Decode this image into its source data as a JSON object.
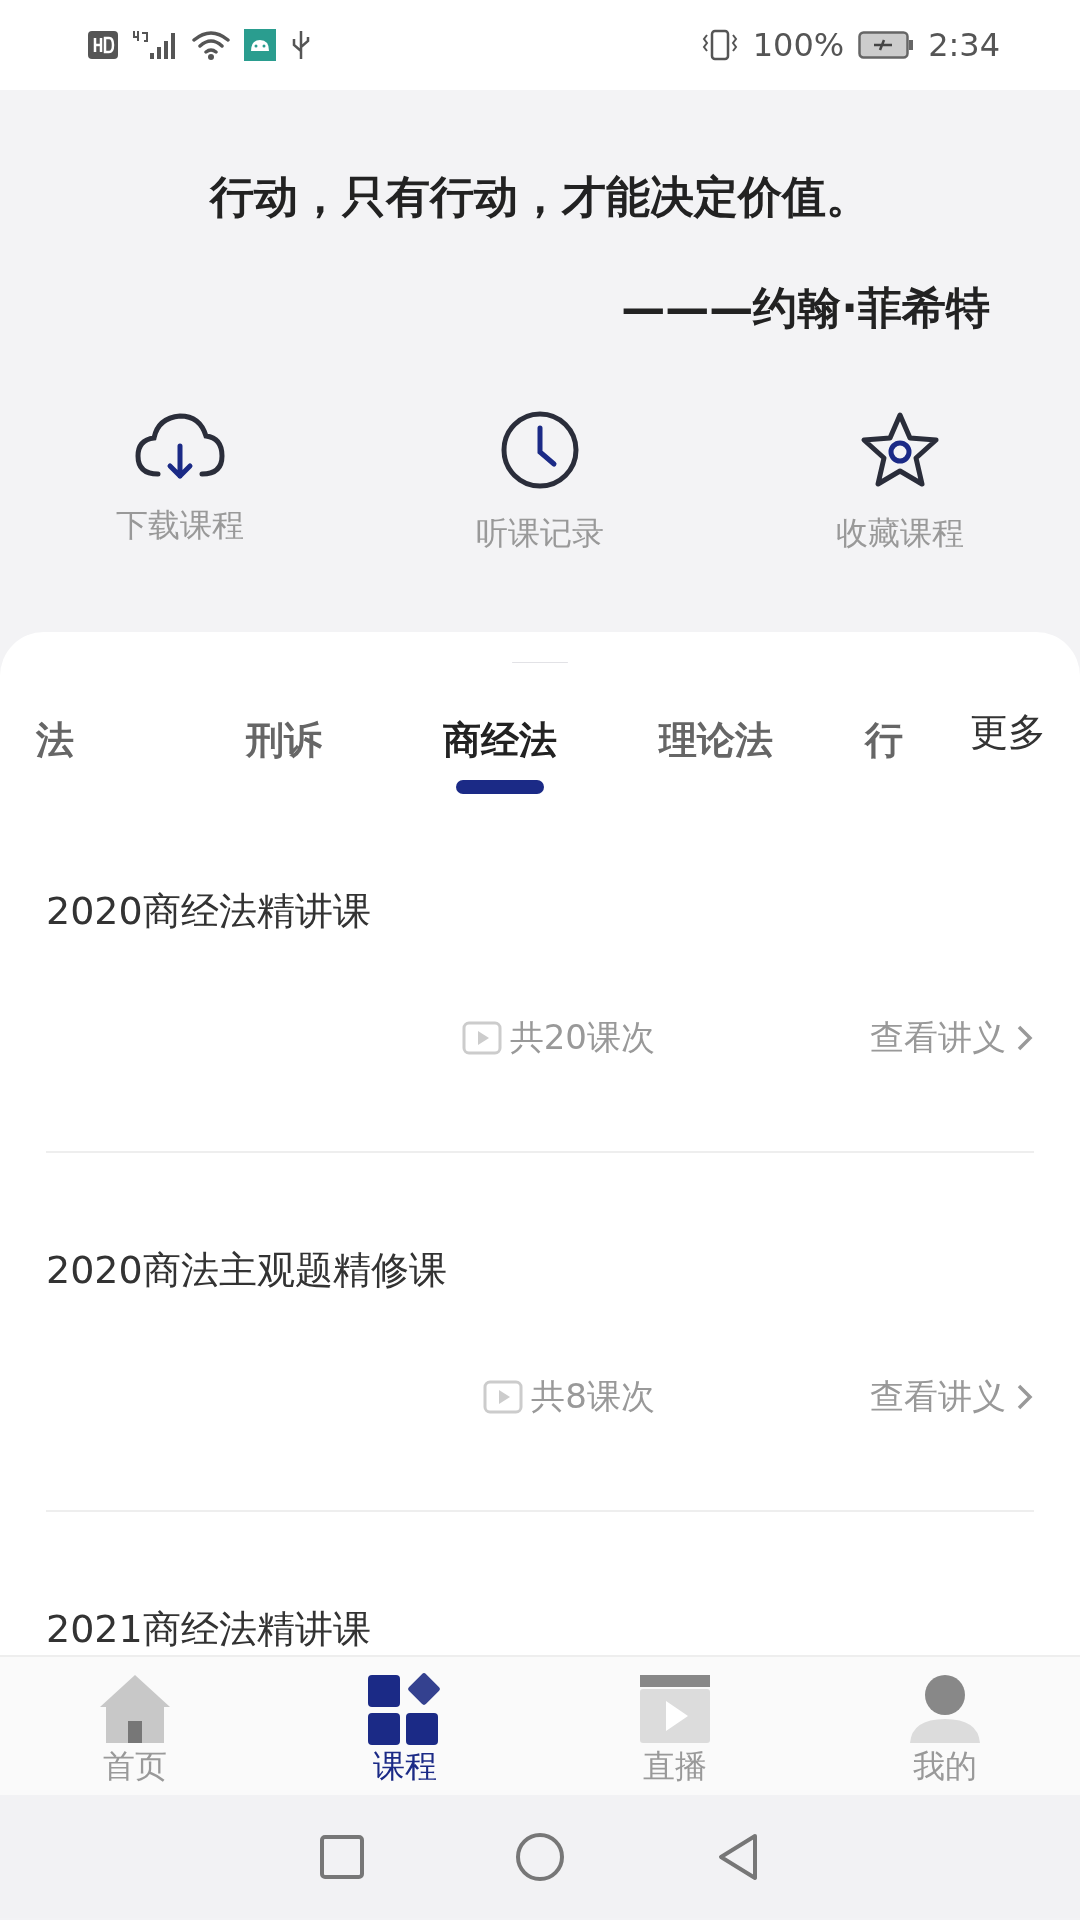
{
  "status_bar": {
    "battery": "100%",
    "time": "2:34"
  },
  "quote": {
    "text": "行动，只有行动，才能决定价值。",
    "author": "———约翰·菲希特"
  },
  "shortcuts": [
    {
      "kind": "download",
      "label": "下载课程"
    },
    {
      "kind": "history",
      "label": "听课记录"
    },
    {
      "kind": "favorite",
      "label": "收藏课程"
    }
  ],
  "tabs": [
    {
      "label": "法",
      "selected": false
    },
    {
      "label": "刑诉",
      "selected": false
    },
    {
      "label": "商经法",
      "selected": true
    },
    {
      "label": "理论法",
      "selected": false
    },
    {
      "label": "行",
      "selected": false
    }
  ],
  "more": "更多",
  "courses": [
    {
      "title": "2020商经法精讲课",
      "count": "共20课次",
      "action": "查看讲义"
    },
    {
      "title": "2020商法主观题精修课",
      "count": "共8课次",
      "action": "查看讲义"
    },
    {
      "title": "2021商经法精讲课"
    }
  ],
  "bottom_nav": [
    {
      "kind": "home",
      "label": "首页",
      "selected": false
    },
    {
      "kind": "courses",
      "label": "课程",
      "selected": true
    },
    {
      "kind": "live",
      "label": "直播",
      "selected": false
    },
    {
      "kind": "profile",
      "label": "我的",
      "selected": false
    }
  ]
}
